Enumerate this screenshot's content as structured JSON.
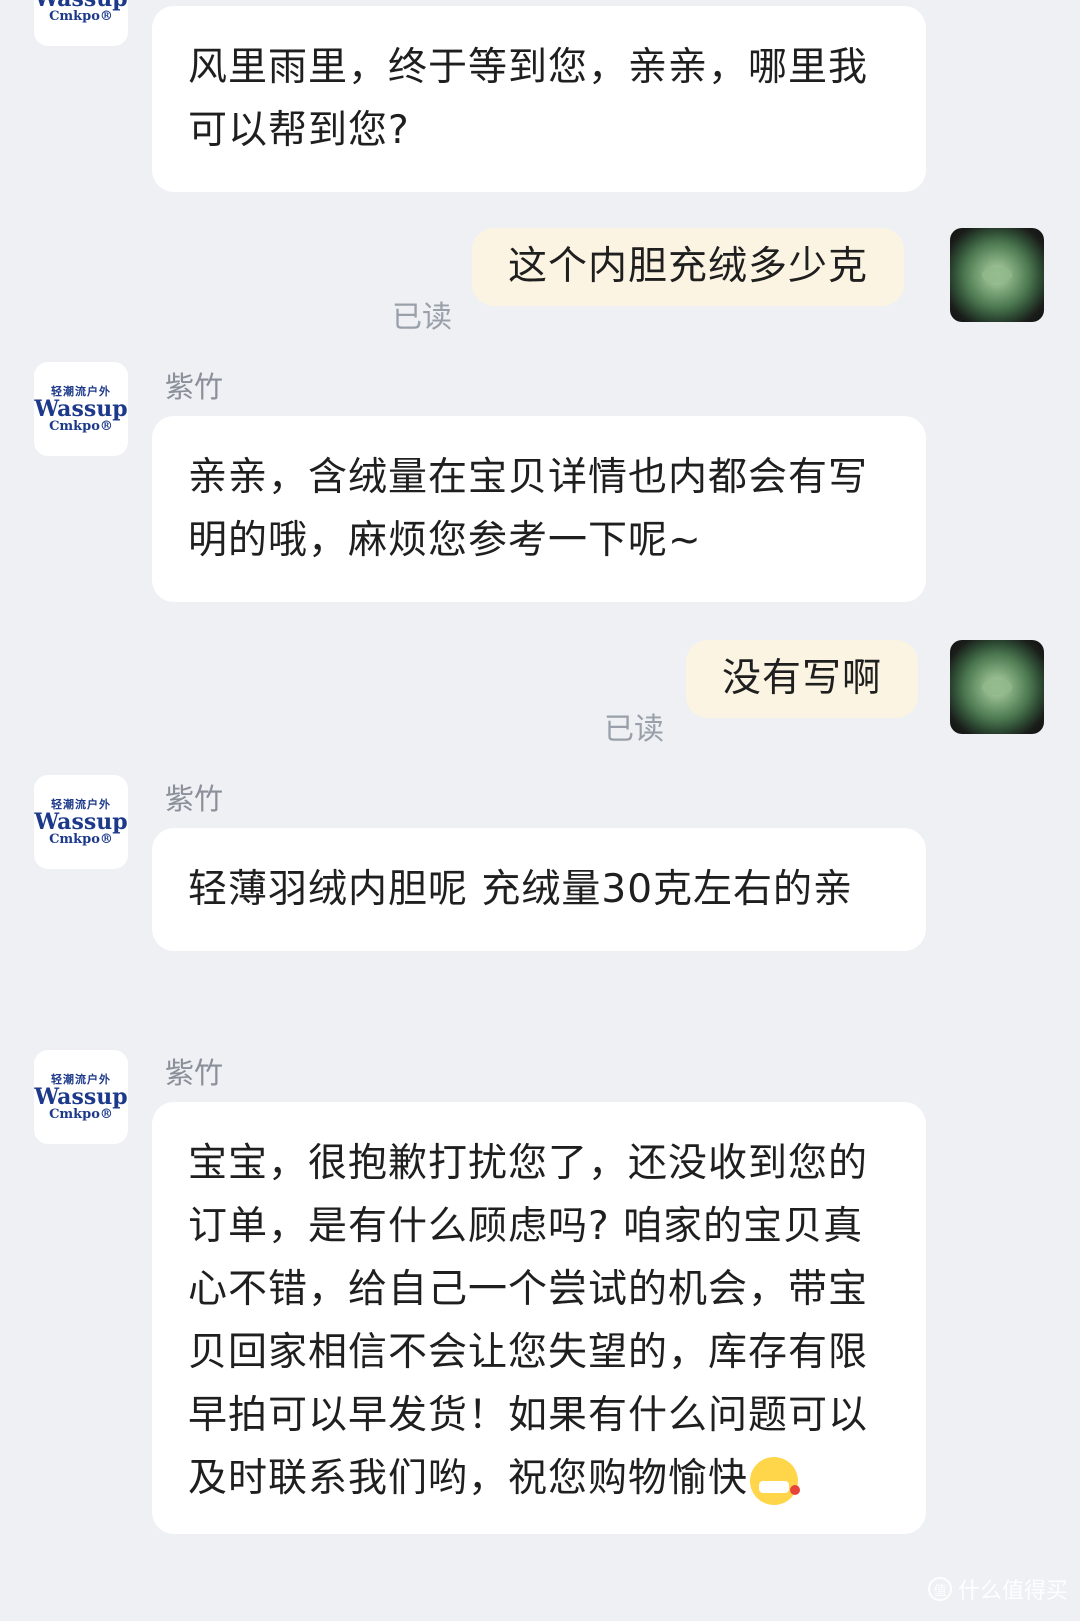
{
  "shop": {
    "logo_sub": "轻潮流户外",
    "logo_main": "Wassup",
    "logo_tail": "Cmkpo®"
  },
  "messages": [
    {
      "type": "shop",
      "text": "风里雨里，终于等到您，亲亲，哪里我可以帮到您?"
    },
    {
      "type": "me",
      "text": "这个内胆充绒多少克",
      "status": "已读"
    },
    {
      "type": "shop",
      "sender": "紫竹",
      "text": "亲亲，含绒量在宝贝详情也内都会有写明的哦，麻烦您参考一下呢~"
    },
    {
      "type": "me",
      "text": "没有写啊",
      "status": "已读"
    },
    {
      "type": "shop",
      "sender": "紫竹",
      "text": "轻薄羽绒内胆呢 充绒量30克左右的亲"
    },
    {
      "type": "shop",
      "sender": "紫竹",
      "text": "宝宝，很抱歉打扰您了，还没收到您的订单，是有什么顾虑吗? 咱家的宝贝真心不错，给自己一个尝试的机会，带宝贝回家相信不会让您失望的，库存有限早拍可以早发货！如果有什么问题可以及时联系我们哟，祝您购物愉快"
    }
  ],
  "watermark": {
    "icon": "值",
    "text": "什么值得买"
  }
}
